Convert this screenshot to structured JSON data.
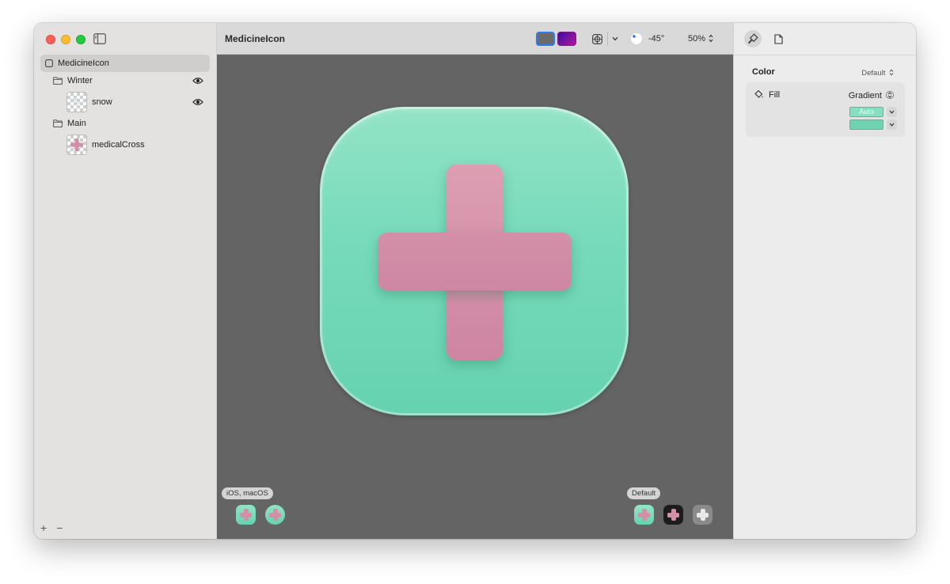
{
  "window": {
    "document_title": "MedicineIcon"
  },
  "sidebar": {
    "items": [
      {
        "label": "MedicineIcon",
        "icon": "square-icon",
        "selected": true
      },
      {
        "label": "Winter",
        "icon": "folder-icon",
        "visible": true
      },
      {
        "label": "snow",
        "icon": "layer-thumbnail",
        "visible": true
      },
      {
        "label": "Main",
        "icon": "folder-icon"
      },
      {
        "label": "medicalCross",
        "icon": "layer-thumbnail"
      }
    ],
    "add_label": "+",
    "remove_label": "−"
  },
  "toolbar": {
    "light_angle": "-45°",
    "zoom": "50%"
  },
  "canvas": {
    "platform_label": "iOS, macOS",
    "appearance_label": "Default"
  },
  "inspector": {
    "section_title": "Color",
    "section_value": "Default",
    "fill_label": "Fill",
    "fill_value": "Gradient",
    "gradient_auto_label": "Auto"
  },
  "colors": {
    "accent": "#2f7bf6",
    "tile_top": "#93e4c6",
    "tile_bottom": "#66d2b0",
    "cross_top": "#dd9eb2",
    "cross_bottom": "#cd85a2",
    "canvas_bg": "#646464"
  }
}
